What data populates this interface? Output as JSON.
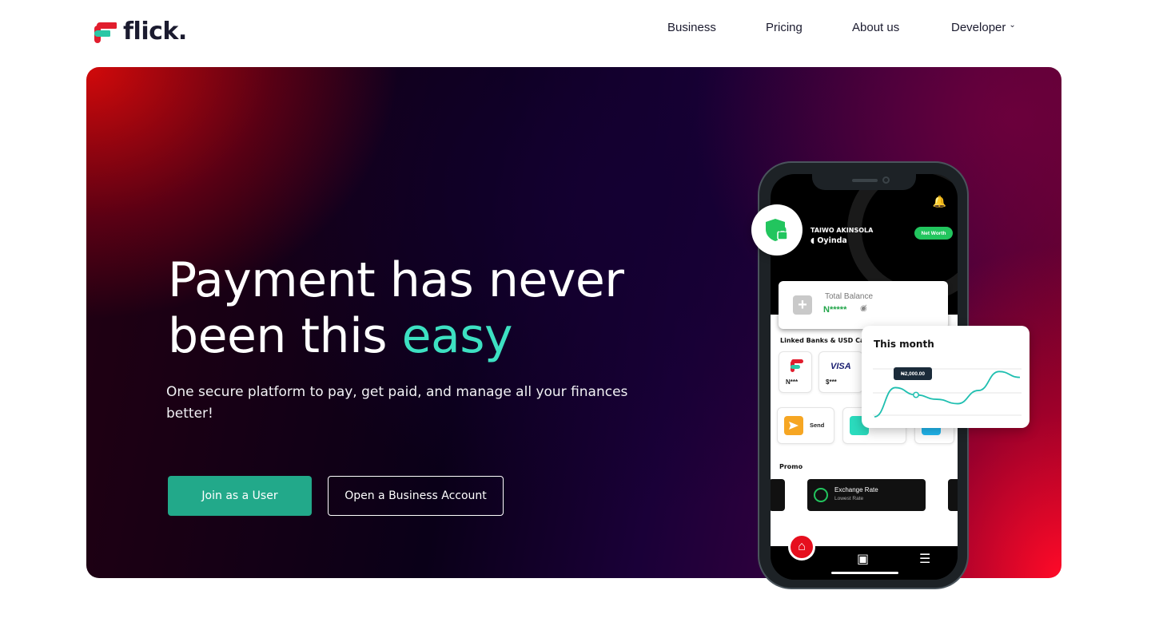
{
  "brand": {
    "name": "flick.",
    "accent": "#2bc7a6",
    "primary": "#22a98a",
    "red": "#e11d2d"
  },
  "nav": {
    "items": [
      {
        "label": "Business"
      },
      {
        "label": "Pricing"
      },
      {
        "label": "About us"
      },
      {
        "label": "Developer",
        "has_dropdown": true
      }
    ]
  },
  "hero": {
    "title_line1": "Payment has never",
    "title_line2_prefix": "been this ",
    "title_line2_accent": "easy",
    "subtitle": "One secure platform to pay, get paid, and manage all your finances better!",
    "primary_button": "Join as a User",
    "secondary_button": "Open a Business Account"
  },
  "phone": {
    "user_name": "TAIWO AKINSOLA",
    "user_handle": "Oyinda",
    "badge": "Net Worth",
    "balance_label": "Total Balance",
    "balance_value": "N*****",
    "linked_label": "Linked Banks & USD Cards",
    "linked_items": [
      {
        "label": "N***",
        "icon": "flick-logo-icon"
      },
      {
        "label": "$***",
        "icon": "visa-icon",
        "brand_text": "VISA"
      }
    ],
    "actions": [
      {
        "label": "Send",
        "icon": "send-icon"
      }
    ],
    "promo_label": "Promo",
    "promo_title": "Exchange Rate",
    "promo_subtitle": "Lowest Rate",
    "tabs": [
      "home-icon",
      "wallet-icon",
      "menu-icon"
    ]
  },
  "chart_card": {
    "title": "This month",
    "tooltip": "₦2,000.00"
  },
  "chart_data": {
    "type": "line",
    "title": "This month",
    "series": [
      {
        "values": [
          0,
          4,
          3,
          2.4,
          1.8,
          3.6,
          6.2,
          5.4
        ]
      }
    ],
    "ylim": [
      0,
      7
    ],
    "grid": true,
    "highlight_index": 2,
    "highlight_label": "₦2,000.00"
  }
}
